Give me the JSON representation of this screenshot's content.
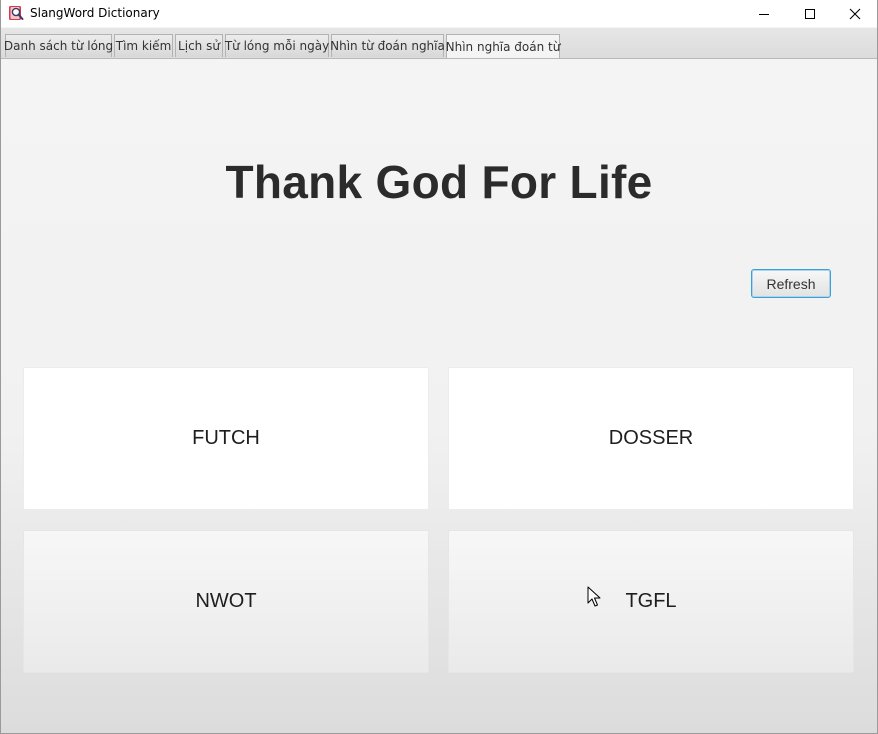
{
  "window": {
    "title": "SlangWord Dictionary"
  },
  "tabs": [
    {
      "label": "Danh sách từ lóng"
    },
    {
      "label": "Tìm kiếm"
    },
    {
      "label": "Lịch sử"
    },
    {
      "label": "Từ lóng mỗi ngày"
    },
    {
      "label": "Nhìn từ đoán nghĩa"
    },
    {
      "label": "Nhìn nghĩa đoán từ",
      "selected": true
    }
  ],
  "quiz": {
    "meaning": "Thank God For Life",
    "refresh_label": "Refresh",
    "answers": [
      "FUTCH",
      "DOSSER",
      "NWOT",
      "TGFL"
    ]
  },
  "colors": {
    "refresh_border": "#3c9fd6",
    "title_text": "#2b2b2b"
  }
}
